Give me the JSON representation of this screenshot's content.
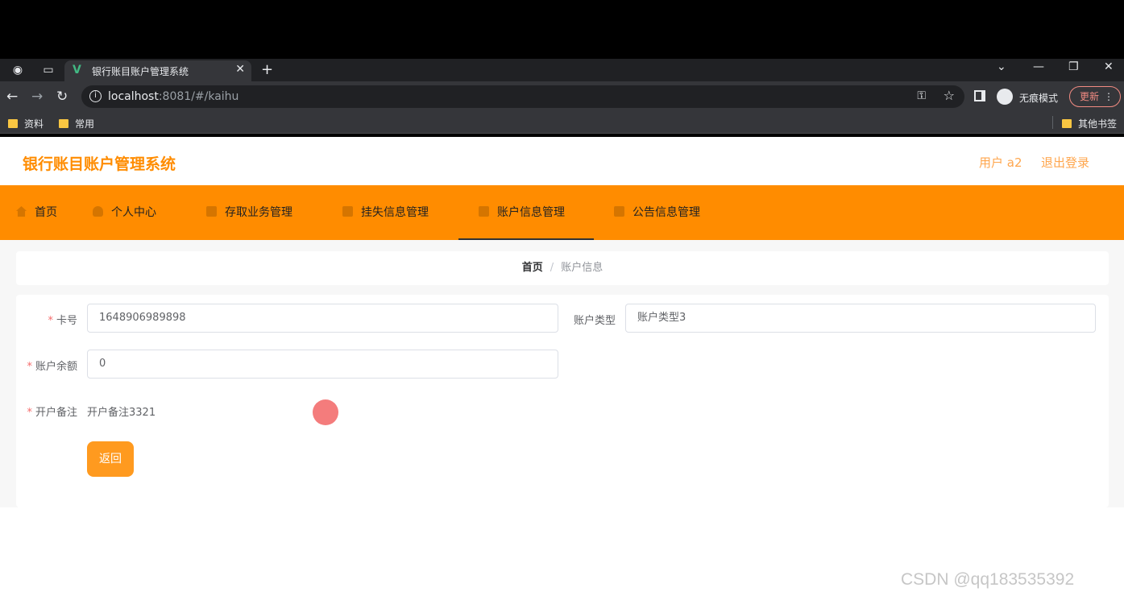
{
  "browser": {
    "tab_title": "银行账目账户管理系统",
    "url_host": "localhost",
    "url_rest": ":8081/#/kaihu",
    "incognito_label": "无痕模式",
    "update_label": "更新",
    "bookmarks": [
      "资料",
      "常用"
    ],
    "other_bookmarks": "其他书签"
  },
  "header": {
    "site_title": "银行账目账户管理系统",
    "user_label": "用户 a2",
    "logout_label": "退出登录"
  },
  "nav": {
    "items": [
      {
        "label": "首页",
        "icon": "home-icon"
      },
      {
        "label": "个人中心",
        "icon": "user-icon"
      },
      {
        "label": "存取业务管理",
        "icon": "doc-icon"
      },
      {
        "label": "挂失信息管理",
        "icon": "card-icon"
      },
      {
        "label": "账户信息管理",
        "icon": "pin-icon"
      },
      {
        "label": "公告信息管理",
        "icon": "notice-icon"
      }
    ],
    "active_index": 4
  },
  "breadcrumb": {
    "home": "首页",
    "separator": "/",
    "current": "账户信息"
  },
  "form": {
    "card_no": {
      "label": "卡号",
      "value": "1648906989898",
      "required": true
    },
    "account_type": {
      "label": "账户类型",
      "value": "账户类型3",
      "required": false
    },
    "balance": {
      "label": "账户余额",
      "value": "0",
      "required": true
    },
    "remark": {
      "label": "开户备注",
      "value": "开户备注3321",
      "required": true
    },
    "back_label": "返回"
  },
  "watermark": "CSDN @qq183535392",
  "colors": {
    "accent": "#ff8c00",
    "required": "#f56c6c"
  }
}
